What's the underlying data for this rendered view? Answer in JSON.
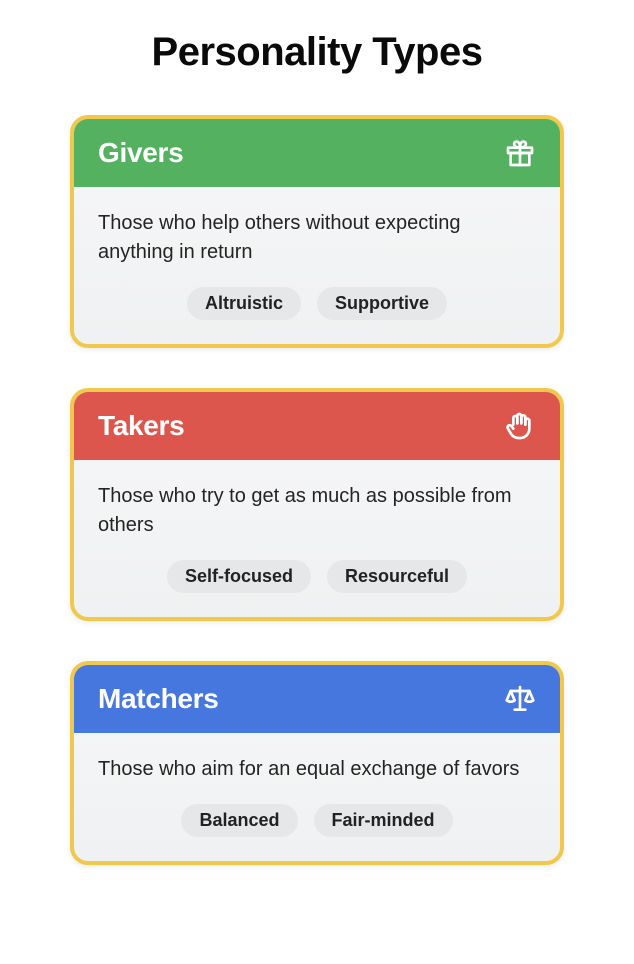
{
  "title": "Personality Types",
  "cards": [
    {
      "title": "Givers",
      "icon": "gift-icon",
      "headerColor": "hdr-green",
      "description": "Those who help others without expecting anything in return",
      "tags": [
        "Altruistic",
        "Supportive"
      ]
    },
    {
      "title": "Takers",
      "icon": "hand-icon",
      "headerColor": "hdr-red",
      "description": "Those who try to get as much as possible from others",
      "tags": [
        "Self-focused",
        "Resourceful"
      ]
    },
    {
      "title": "Matchers",
      "icon": "scale-icon",
      "headerColor": "hdr-blue",
      "description": "Those who aim for an equal exchange of favors",
      "tags": [
        "Balanced",
        "Fair-minded"
      ]
    }
  ]
}
